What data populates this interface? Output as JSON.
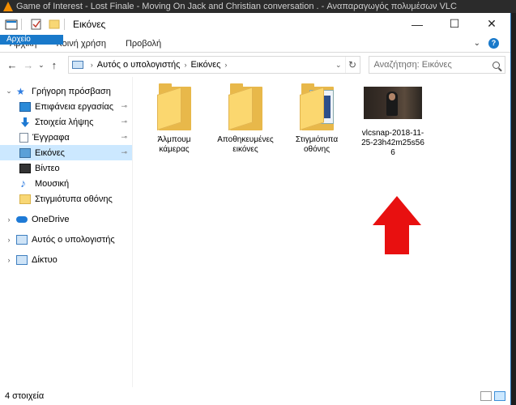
{
  "background_window": {
    "title": "Game of Interest - Lost Finale - Moving On Jack and Christian conversation . - Αναπαραγωγός πολυμέσων VLC"
  },
  "window": {
    "title": "Εικόνες",
    "controls": {
      "minimize": "—",
      "maximize": "☐",
      "close": "✕"
    }
  },
  "ribbon": {
    "tabs": [
      "Αρχείο",
      "Αρχική",
      "Κοινή χρήση",
      "Προβολή"
    ],
    "expand": "⌄",
    "help": "?"
  },
  "address": {
    "back": "←",
    "forward": "→",
    "recent": "⌄",
    "up": "↑",
    "crumbs": [
      "Αυτός ο υπολογιστής",
      "Εικόνες"
    ],
    "separator": "›",
    "dropdown": "⌄",
    "refresh": "↻",
    "search_placeholder": "Αναζήτηση: Εικόνες"
  },
  "nav": {
    "quick_access": "Γρήγορη πρόσβαση",
    "items": [
      {
        "label": "Επιφάνεια εργασίας",
        "icon": "desktop-icon",
        "pinned": true
      },
      {
        "label": "Στοιχεία λήψης",
        "icon": "downloads-icon",
        "pinned": true
      },
      {
        "label": "Έγγραφα",
        "icon": "documents-icon",
        "pinned": true
      },
      {
        "label": "Εικόνες",
        "icon": "pictures-icon",
        "pinned": true,
        "selected": true
      },
      {
        "label": "Βίντεο",
        "icon": "videos-icon",
        "pinned": false
      },
      {
        "label": "Μουσική",
        "icon": "music-icon",
        "pinned": false
      },
      {
        "label": "Στιγμιότυπα οθόνης",
        "icon": "folder-icon",
        "pinned": false
      }
    ],
    "onedrive": "OneDrive",
    "this_pc": "Αυτός ο υπολογιστής",
    "network": "Δίκτυο",
    "pin_glyph": "📌",
    "chev_open": "⌄",
    "chev_closed": "›"
  },
  "files": [
    {
      "name": "Άλμπουμ κάμερας",
      "type": "folder"
    },
    {
      "name": "Αποθηκευμένες εικόνες",
      "type": "folder"
    },
    {
      "name": "Στιγμιότυπα οθόνης",
      "type": "screenshot-folder"
    },
    {
      "name": "vlcsnap-2018-11-25-23h42m25s566",
      "type": "image"
    }
  ],
  "status": {
    "count": "4 στοιχεία"
  },
  "colors": {
    "accent": "#1979ca",
    "selection": "#cce8ff",
    "arrow": "#e81010"
  }
}
